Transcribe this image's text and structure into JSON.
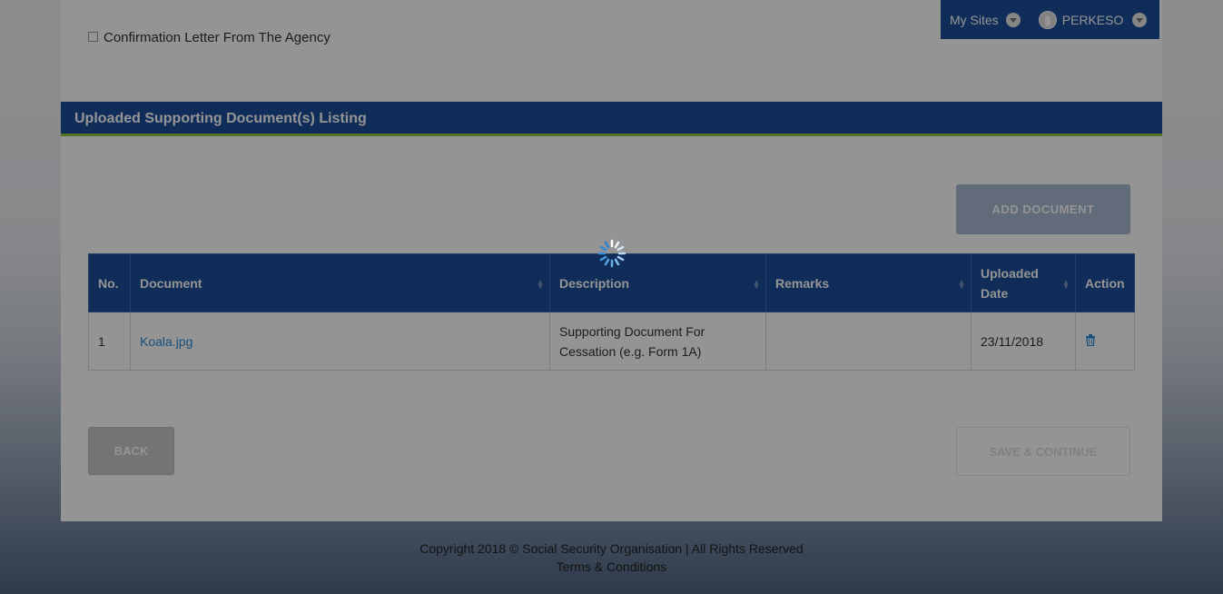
{
  "form": {
    "checkbox_label": "Confirmation Letter From The Agency"
  },
  "section": {
    "title": "Uploaded Supporting Document(s) Listing",
    "add_button": "ADD DOCUMENT"
  },
  "table": {
    "headers": {
      "no": "No.",
      "document": "Document",
      "description": "Description",
      "remarks": "Remarks",
      "uploaded_date": "Uploaded Date",
      "action": "Action"
    },
    "rows": [
      {
        "no": "1",
        "document": "Koala.jpg",
        "description": "Supporting Document For Cessation (e.g. Form 1A)",
        "remarks": "",
        "uploaded_date": "23/11/2018",
        "action_icon": "trash-icon"
      }
    ]
  },
  "buttons": {
    "back": "BACK",
    "save_continue": "SAVE & CONTINUE"
  },
  "topnav": {
    "my_sites": "My Sites",
    "user": "PERKESO"
  },
  "footer": {
    "copyright": "Copyright 2018 © Social Security Organisation | All Rights Reserved",
    "terms": "Terms & Conditions"
  },
  "loading": true,
  "colors": {
    "primary": "#1d4f9c",
    "accent_green": "#8dc63f",
    "link": "#2d8ad8"
  }
}
